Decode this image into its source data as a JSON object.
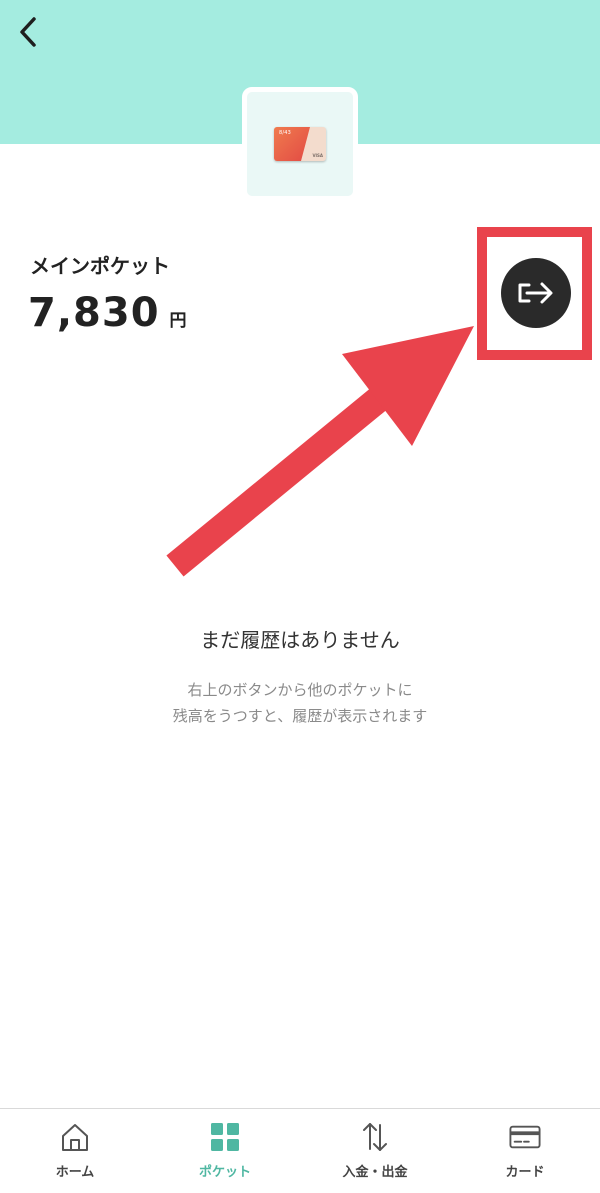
{
  "header": {
    "background_color": "#a4ece0",
    "back_icon": "chevron-left-icon"
  },
  "pocket": {
    "card_number": "8/43",
    "card_brand": "VISA",
    "name": "メインポケット",
    "balance": "7,830",
    "currency": "円",
    "transfer_icon": "arrow-right-from-bracket-icon"
  },
  "annotation": {
    "color": "#e9434c"
  },
  "history": {
    "empty_title": "まだ履歴はありません",
    "empty_desc_line1": "右上のボタンから他のポケットに",
    "empty_desc_line2": "残高をうつすと、履歴が表示されます"
  },
  "nav": {
    "accent_color": "#4fb7a2",
    "items": [
      {
        "label": "ホーム",
        "icon": "home-icon"
      },
      {
        "label": "ポケット",
        "icon": "grid-icon",
        "active": true
      },
      {
        "label": "入金・出金",
        "icon": "up-down-arrows-icon"
      },
      {
        "label": "カード",
        "icon": "credit-card-icon"
      }
    ]
  }
}
